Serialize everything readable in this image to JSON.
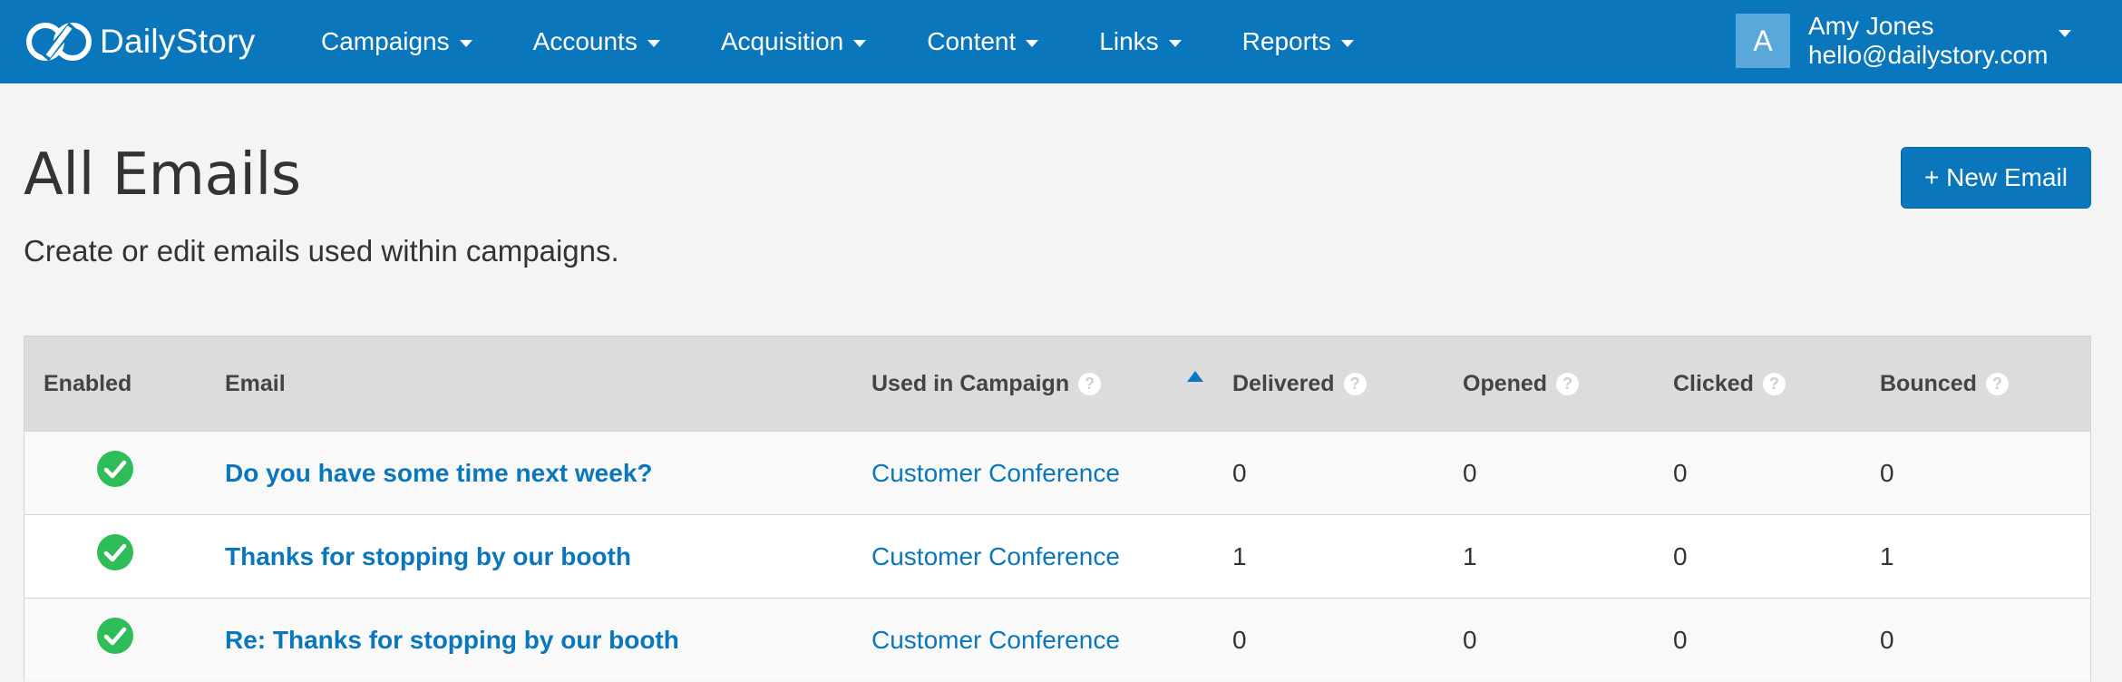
{
  "brand": {
    "name": "DailyStory"
  },
  "nav": {
    "items": [
      {
        "label": "Campaigns"
      },
      {
        "label": "Accounts"
      },
      {
        "label": "Acquisition"
      },
      {
        "label": "Content"
      },
      {
        "label": "Links"
      },
      {
        "label": "Reports"
      }
    ]
  },
  "user": {
    "initial": "A",
    "name": "Amy Jones",
    "email": "hello@dailystory.com"
  },
  "page": {
    "title": "All Emails",
    "subtitle": "Create or edit emails used within campaigns.",
    "new_button": "+ New Email"
  },
  "table": {
    "columns": {
      "enabled": "Enabled",
      "email": "Email",
      "campaign": "Used in Campaign",
      "delivered": "Delivered",
      "opened": "Opened",
      "clicked": "Clicked",
      "bounced": "Bounced"
    },
    "help_glyph": "?",
    "rows": [
      {
        "enabled": true,
        "email": "Do you have some time next week?",
        "campaign": "Customer Conference",
        "delivered": "0",
        "opened": "0",
        "clicked": "0",
        "bounced": "0"
      },
      {
        "enabled": true,
        "email": "Thanks for stopping by our booth",
        "campaign": "Customer Conference",
        "delivered": "1",
        "opened": "1",
        "clicked": "0",
        "bounced": "1"
      },
      {
        "enabled": true,
        "email": "Re: Thanks for stopping by our booth",
        "campaign": "Customer Conference",
        "delivered": "0",
        "opened": "0",
        "clicked": "0",
        "bounced": "0"
      }
    ]
  },
  "colors": {
    "brand_blue": "#0a77bd",
    "enabled_green": "#2ebd59",
    "header_gray": "#dcdcdc",
    "page_bg": "#f4f4f4"
  },
  "icons": {
    "logo": "infinity-logo-icon",
    "enabled": "check-circle-icon",
    "sort": "sort-ascending-icon",
    "help": "question-circle-icon"
  }
}
